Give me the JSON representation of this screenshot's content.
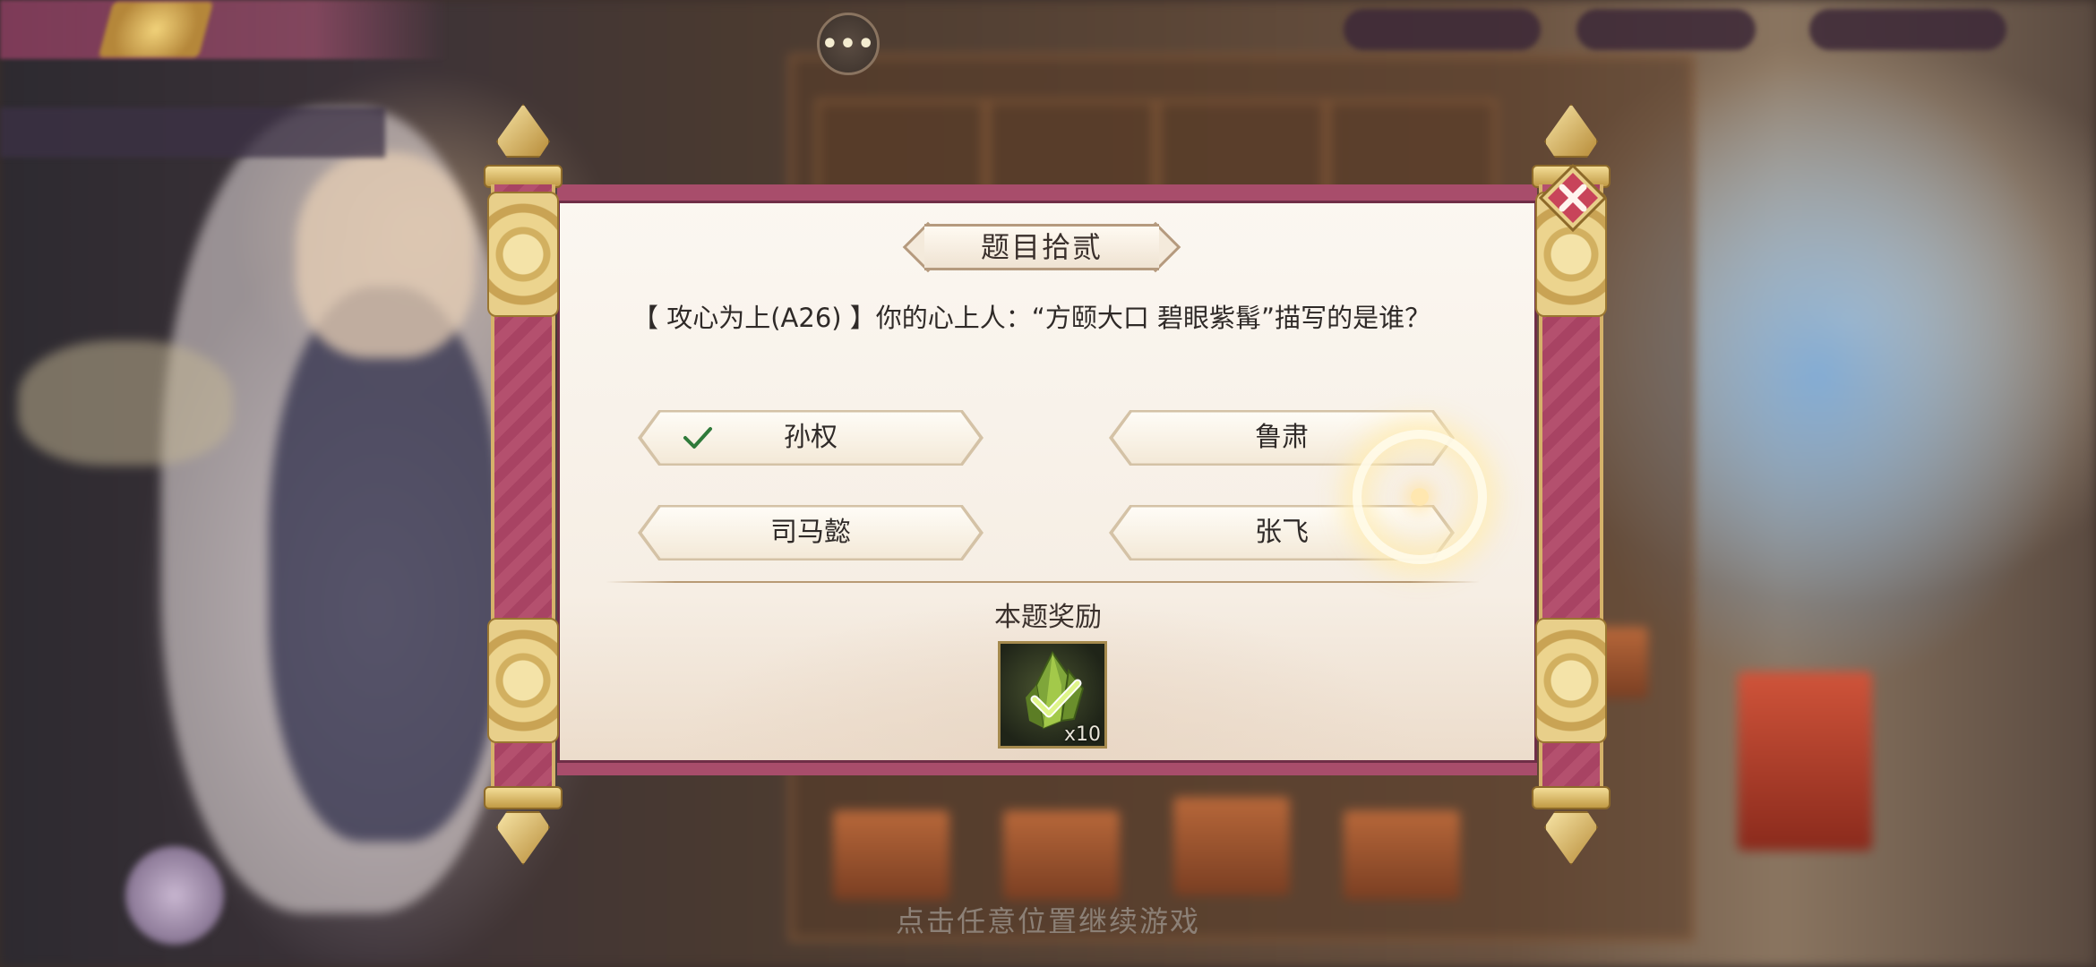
{
  "hud": {
    "event_title": "",
    "event_subtitle": "",
    "chat_icon": "chat-bubble-icon",
    "chat_glyph": "•••",
    "currencies": [
      "",
      "",
      ""
    ]
  },
  "quiz": {
    "title": "题目拾贰",
    "question": "【 攻心为上(A26) 】你的心上人：“方颐大口 碧眼紫髯”描写的是谁？",
    "options": [
      {
        "label": "孙权",
        "correct": true
      },
      {
        "label": "鲁肃",
        "correct": false
      },
      {
        "label": "司马懿",
        "correct": false
      },
      {
        "label": "张飞",
        "correct": false
      }
    ],
    "reward": {
      "label": "本题奖励",
      "item_icon": "green-crystal-icon",
      "count": "x10",
      "claimed": true
    }
  },
  "footer": {
    "continue_hint": "点击任意位置继续游戏"
  },
  "colors": {
    "scroll_pink": "#a84d6b",
    "scroll_gold": "#d6b26a",
    "paper": "#fbf7f1",
    "check_green": "#2f7a3a",
    "close_red": "#c8445a"
  }
}
